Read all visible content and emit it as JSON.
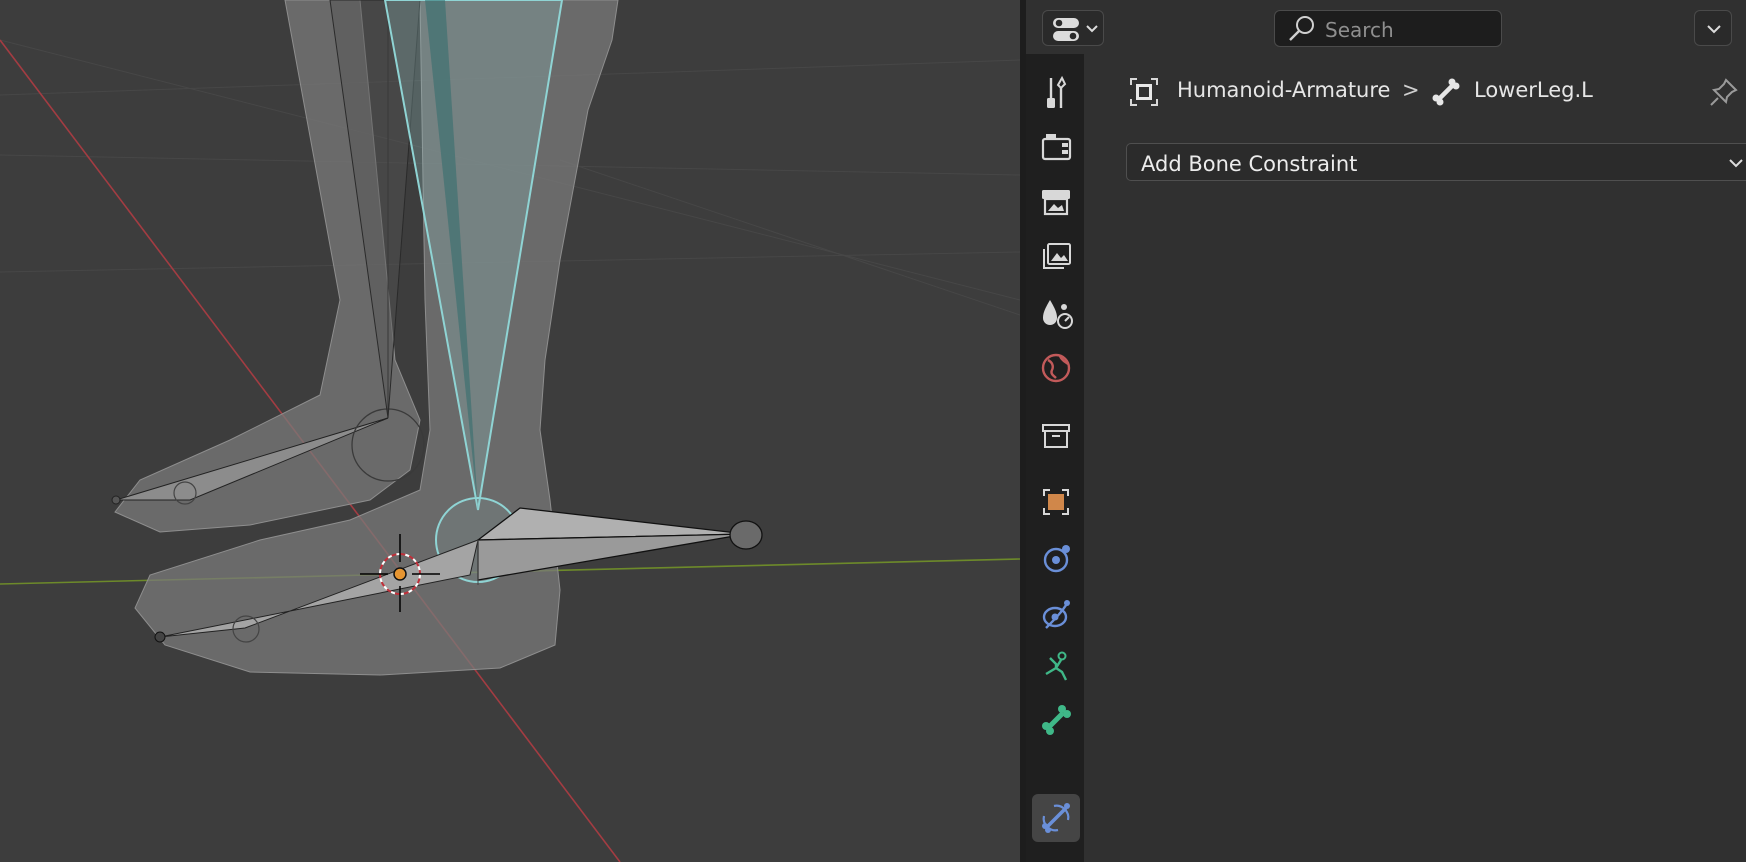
{
  "search": {
    "placeholder": "Search"
  },
  "breadcrumb": {
    "object_name": "Humanoid-Armature",
    "separator": ">",
    "bone_name": "LowerLeg.L"
  },
  "panel": {
    "add_constraint_label": "Add Bone Constraint"
  },
  "tabs": [
    {
      "name": "tool",
      "icon": "tool-icon"
    },
    {
      "name": "render",
      "icon": "render-icon"
    },
    {
      "name": "output",
      "icon": "output-icon"
    },
    {
      "name": "view-layer",
      "icon": "view-layer-icon"
    },
    {
      "name": "scene",
      "icon": "scene-icon"
    },
    {
      "name": "world",
      "icon": "world-icon"
    },
    {
      "name": "collection",
      "icon": "collection-icon"
    },
    {
      "name": "object",
      "icon": "object-icon"
    },
    {
      "name": "modifiers",
      "icon": "modifier-icon"
    },
    {
      "name": "physics",
      "icon": "physics-icon"
    },
    {
      "name": "object-data",
      "icon": "armature-data-icon"
    },
    {
      "name": "bone",
      "icon": "bone-icon"
    },
    {
      "name": "bone-constraints",
      "icon": "bone-constraint-icon",
      "active": true
    }
  ],
  "colors": {
    "viewport_bg": "#3d3d3d",
    "x_axis": "#a33c42",
    "y_axis": "#6d8a2a",
    "active_bone": "#8fd4d4",
    "accent_orange": "#d0874a",
    "accent_blue": "#6a8fd8",
    "accent_green": "#3fb888"
  }
}
